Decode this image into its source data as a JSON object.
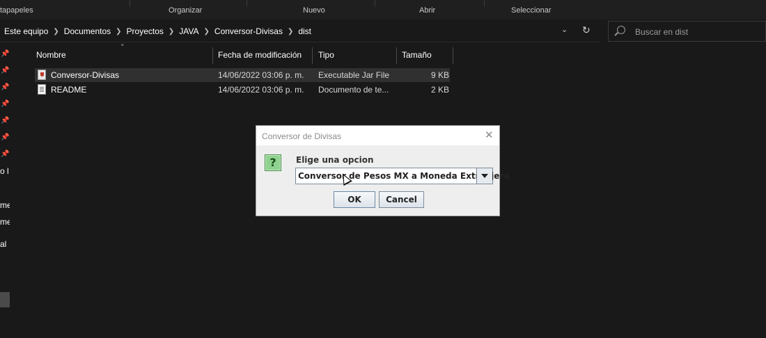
{
  "ribbon": {
    "groups": [
      "tapapeles",
      "Organizar",
      "Nuevo",
      "Abrir",
      "Seleccionar"
    ]
  },
  "address": {
    "crumbs": [
      "Este equipo",
      "Documentos",
      "Proyectos",
      "JAVA",
      "Conversor-Divisas",
      "dist"
    ]
  },
  "search": {
    "placeholder": "Buscar en dist"
  },
  "nav": {
    "partial_labels": [
      "o l",
      "me",
      "me",
      "al"
    ]
  },
  "columns": {
    "name": "Nombre",
    "date": "Fecha de modificación",
    "type": "Tipo",
    "size": "Tamaño"
  },
  "files": [
    {
      "name": "Conversor-Divisas",
      "date": "14/06/2022 03:06 p. m.",
      "type": "Executable Jar File",
      "size": "9 KB",
      "icon": "jar-file-icon",
      "selected": true
    },
    {
      "name": "README",
      "date": "14/06/2022 03:06 p. m.",
      "type": "Documento de te...",
      "size": "2 KB",
      "icon": "text-file-icon",
      "selected": false
    }
  ],
  "dialog": {
    "title": "Conversor de Divisas",
    "icon": "question-icon",
    "prompt": "Elige una opcion",
    "selected_option": "Conversor de Pesos MX a Moneda Extranjera",
    "ok_label": "OK",
    "cancel_label": "Cancel"
  }
}
